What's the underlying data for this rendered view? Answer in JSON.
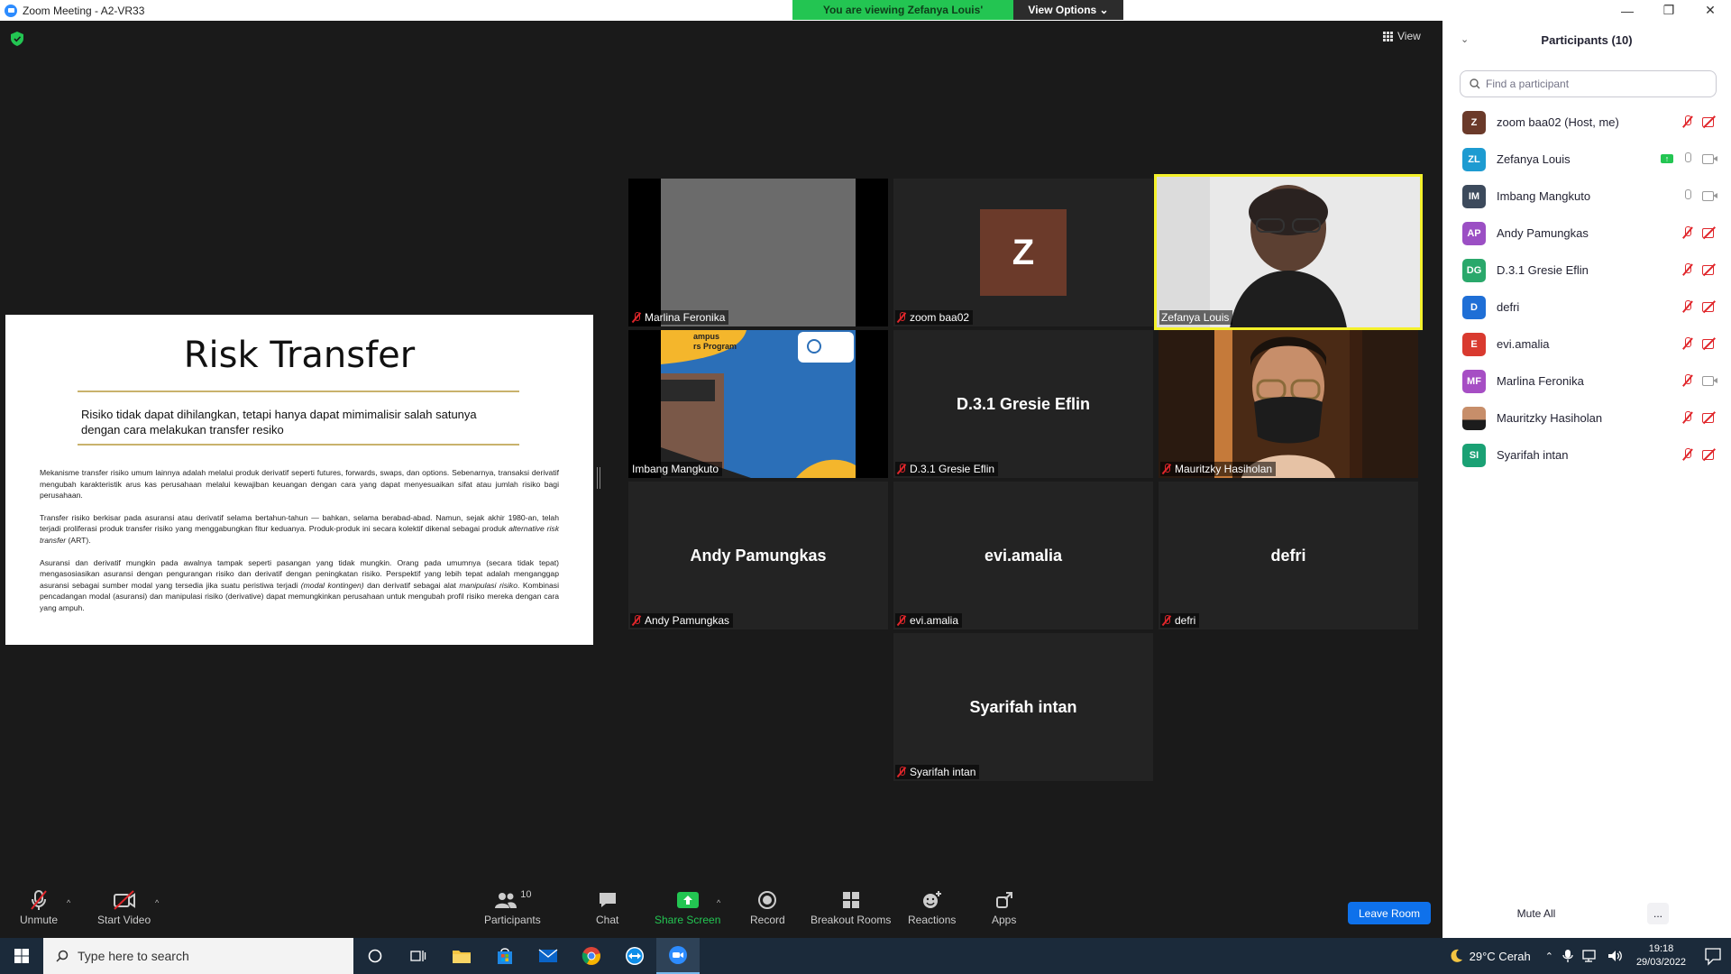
{
  "window": {
    "title": "Zoom Meeting - A2-VR33",
    "minimize_glyph": "—",
    "restore_glyph": "❐",
    "close_glyph": "✕"
  },
  "share_banner": {
    "message": "You are viewing Zefanya Louis' screen",
    "options_label": "View Options ⌄"
  },
  "view_button": {
    "label": "View"
  },
  "slide": {
    "title": "Risk Transfer",
    "lead": "Risiko tidak dapat dihilangkan, tetapi hanya dapat mimimalisir salah satunya dengan cara melakukan transfer resiko",
    "paragraphs": [
      "Mekanisme transfer risiko umum lainnya adalah melalui produk derivatif seperti futures, forwards, swaps, dan options. Sebenarnya, transaksi derivatif mengubah karakteristik arus kas perusahaan melalui kewajiban keuangan dengan cara yang dapat menyesuaikan sifat atau jumlah risiko bagi perusahaan.",
      "Transfer risiko berkisar pada asuransi atau derivatif selama bertahun-tahun — bahkan, selama berabad-abad. Namun, sejak akhir 1980-an, telah terjadi proliferasi produk transfer risiko yang menggabungkan fitur keduanya. Produk-produk ini secara kolektif dikenal sebagai produk alternative risk transfer (ART).",
      "Asuransi dan derivatif mungkin pada awalnya tampak seperti pasangan yang tidak mungkin. Orang pada umumnya (secara tidak tepat) mengasosiasikan asuransi dengan pengurangan risiko dan derivatif dengan peningkatan risiko. Perspektif yang lebih tepat adalah menganggap asuransi sebagai sumber modal yang tersedia jika suatu peristiwa terjadi (modal kontingen) dan derivatif sebagai alat manipulasi risiko. Kombinasi pencadangan modal (asuransi) dan manipulasi risiko (derivative) dapat memungkinkan perusahaan untuk mengubah profil risiko mereka dengan cara yang ampuh."
    ]
  },
  "tiles": [
    {
      "label": "Marlina Feronika",
      "display": "",
      "kind": "gray"
    },
    {
      "label": "zoom baa02",
      "display": "Z",
      "kind": "avatar"
    },
    {
      "label": "Zefanya Louis",
      "display": "",
      "kind": "video-active"
    },
    {
      "label": "Imbang Mangkuto",
      "display": "",
      "kind": "video-imbang"
    },
    {
      "label": "D.3.1 Gresie Eflin",
      "display": "D.3.1 Gresie Eflin",
      "kind": "name"
    },
    {
      "label": "Mauritzky Hasiholan",
      "display": "",
      "kind": "video-mauritzky"
    },
    {
      "label": "Andy Pamungkas",
      "display": "Andy Pamungkas",
      "kind": "name"
    },
    {
      "label": "evi.amalia",
      "display": "evi.amalia",
      "kind": "name"
    },
    {
      "label": "defri",
      "display": "defri",
      "kind": "name"
    },
    {
      "label": "Syarifah intan",
      "display": "Syarifah intan",
      "kind": "name"
    }
  ],
  "imbang_banner": {
    "line1": "ampus",
    "line2": "rs Program"
  },
  "toolbar": {
    "unmute": "Unmute",
    "start_video": "Start Video",
    "participants": "Participants",
    "participants_count": "10",
    "chat": "Chat",
    "share_screen": "Share Screen",
    "record": "Record",
    "breakout_rooms": "Breakout Rooms",
    "reactions": "Reactions",
    "apps": "Apps",
    "leave": "Leave Room",
    "caret_glyph": "^"
  },
  "panel": {
    "title": "Participants (10)",
    "collapse_glyph": "⌄",
    "search_placeholder": "Find a participant",
    "mute_all": "Mute All",
    "more": "...",
    "participants": [
      {
        "initials": "Z",
        "name": "zoom baa02 (Host, me)",
        "color": "#6b3a2a",
        "mic": "muted",
        "video": "off",
        "sharing": false
      },
      {
        "initials": "ZL",
        "name": "Zefanya Louis",
        "color": "#1d9bd1",
        "mic": "on",
        "video": "on",
        "sharing": true
      },
      {
        "initials": "IM",
        "name": "Imbang Mangkuto",
        "color": "#3c4a5c",
        "mic": "on",
        "video": "on",
        "sharing": false
      },
      {
        "initials": "AP",
        "name": "Andy Pamungkas",
        "color": "#9b4fc4",
        "mic": "muted",
        "video": "off",
        "sharing": false
      },
      {
        "initials": "DG",
        "name": "D.3.1 Gresie Eflin",
        "color": "#2aa86b",
        "mic": "muted",
        "video": "off",
        "sharing": false
      },
      {
        "initials": "D",
        "name": "defri",
        "color": "#1f6fd6",
        "mic": "muted",
        "video": "off",
        "sharing": false
      },
      {
        "initials": "E",
        "name": "evi.amalia",
        "color": "#d93a2f",
        "mic": "muted",
        "video": "off",
        "sharing": false
      },
      {
        "initials": "MF",
        "name": "Marlina Feronika",
        "color": "#a64ec4",
        "mic": "muted",
        "video": "on",
        "sharing": false
      },
      {
        "initials": "",
        "name": "Mauritzky Hasiholan",
        "color": "#8a5a3c",
        "mic": "muted",
        "video": "off",
        "sharing": false
      },
      {
        "initials": "SI",
        "name": "Syarifah intan",
        "color": "#1aa174",
        "mic": "muted",
        "video": "off",
        "sharing": false
      }
    ]
  },
  "taskbar": {
    "search_placeholder": "Type here to search",
    "weather": "29°C  Cerah",
    "time": "19:18",
    "date": "29/03/2022"
  }
}
